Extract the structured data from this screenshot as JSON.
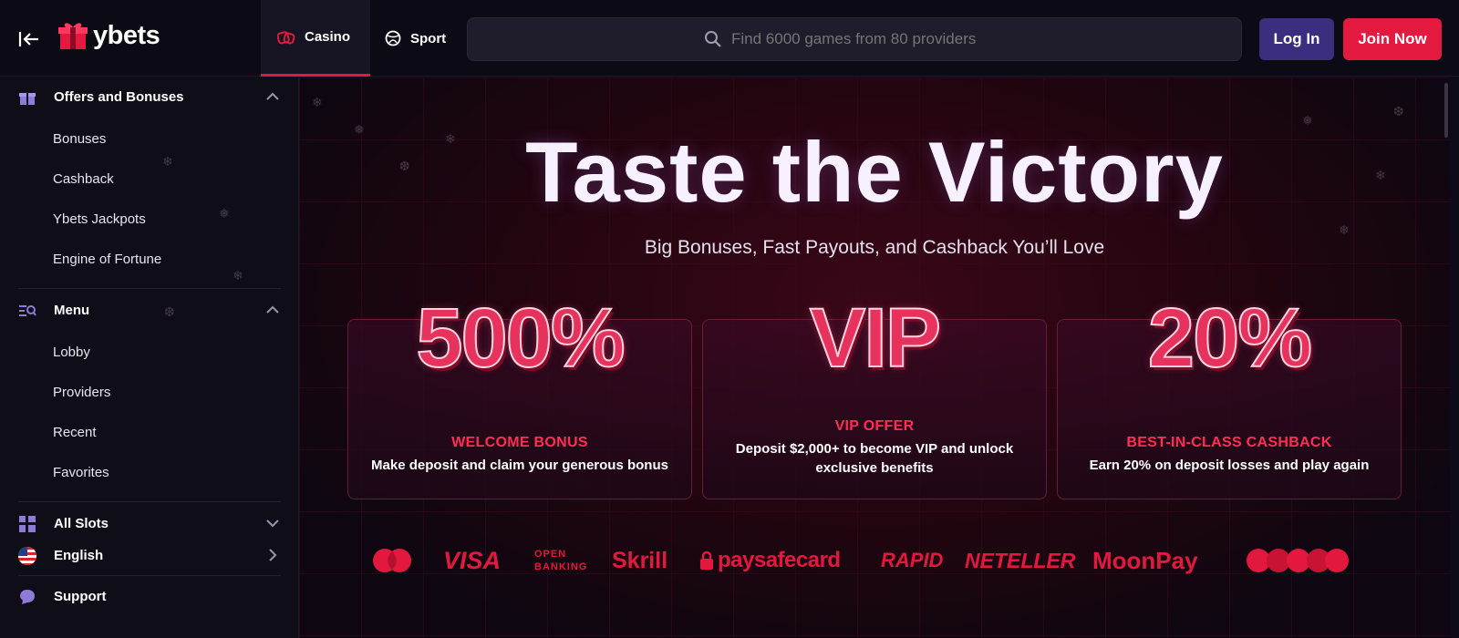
{
  "brand": {
    "name": "ybets"
  },
  "tabs": [
    {
      "label": "Casino",
      "active": true
    },
    {
      "label": "Sport",
      "active": false
    }
  ],
  "search": {
    "placeholder": "Find 6000 games from 80 providers"
  },
  "auth": {
    "login": "Log In",
    "join": "Join Now"
  },
  "sidebar": {
    "offers": {
      "label": "Offers and Bonuses",
      "items": [
        "Bonuses",
        "Cashback",
        "Ybets Jackpots",
        "Engine of Fortune"
      ]
    },
    "menu": {
      "label": "Menu",
      "items": [
        "Lobby",
        "Providers",
        "Recent",
        "Favorites"
      ]
    },
    "slots": {
      "label": "All Slots"
    },
    "language": {
      "label": "English"
    },
    "support": {
      "label": "Support"
    }
  },
  "hero": {
    "title": "Taste the Victory",
    "subtitle": "Big Bonuses, Fast Payouts, and Cashback You’ll Love",
    "cards": [
      {
        "big": "500%",
        "title": "WELCOME BONUS",
        "desc": "Make deposit and claim your generous bonus"
      },
      {
        "big": "VIP",
        "title": "VIP OFFER",
        "desc": "Deposit $2,000+ to become VIP and unlock exclusive benefits"
      },
      {
        "big": "20%",
        "title": "BEST-IN-CLASS CASHBACK",
        "desc": "Earn 20% on deposit losses and play again"
      }
    ]
  },
  "payments": [
    "VISA",
    "OPEN",
    "BANKING",
    "Skrill",
    "paysafecard",
    "RAPID",
    "NETELLER",
    "MoonPay"
  ],
  "colors": {
    "accent": "#e4193f",
    "login_bg": "#3b2e7e",
    "bg": "#0d0b17"
  }
}
